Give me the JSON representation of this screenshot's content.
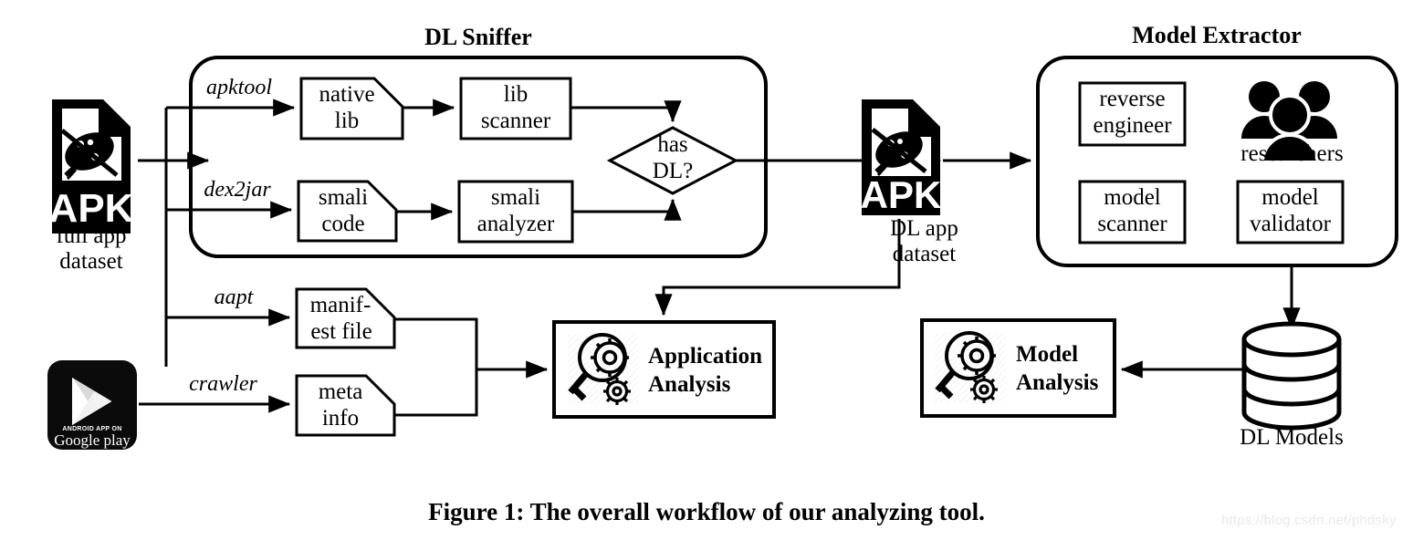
{
  "figure": {
    "caption": "Figure 1: The overall workflow of our analyzing tool.",
    "watermark": "https://blog.csdn.net/phdsky"
  },
  "groups": [
    {
      "id": "dl-sniffer",
      "title": "DL Sniffer"
    },
    {
      "id": "model-extractor",
      "title": "Model Extractor"
    }
  ],
  "sources": [
    {
      "id": "full-app-apk",
      "icon": "apk-file-icon",
      "label_line1": "full app",
      "label_line2": "dataset"
    },
    {
      "id": "google-play",
      "icon": "google-play-badge-icon",
      "badge_top": "ANDROID APP ON",
      "badge_main": "Google play"
    },
    {
      "id": "dl-app-apk",
      "icon": "apk-file-icon",
      "label_line1": "DL app",
      "label_line2": "dataset"
    }
  ],
  "edge_labels": {
    "apktool": "apktool",
    "dex2jar": "dex2jar",
    "aapt": "aapt",
    "crawler": "crawler"
  },
  "sniffer_nodes": [
    {
      "id": "native-lib",
      "shape": "document",
      "line1": "native",
      "line2": "lib"
    },
    {
      "id": "lib-scanner",
      "shape": "rect",
      "line1": "lib",
      "line2": "scanner"
    },
    {
      "id": "smali-code",
      "shape": "document",
      "line1": "smali",
      "line2": "code"
    },
    {
      "id": "smali-analyzer",
      "shape": "rect",
      "line1": "smali",
      "line2": "analyzer"
    },
    {
      "id": "has-dl",
      "shape": "diamond",
      "line1": "has",
      "line2": "DL?"
    }
  ],
  "artifact_nodes": [
    {
      "id": "manifest-file",
      "shape": "document",
      "line1": "manif-",
      "line2": "est file"
    },
    {
      "id": "meta-info",
      "shape": "document",
      "line1": "meta",
      "line2": "info"
    }
  ],
  "extractor_nodes": [
    {
      "id": "reverse-engineer",
      "shape": "rect",
      "line1": "reverse",
      "line2": "engineer"
    },
    {
      "id": "model-scanner",
      "shape": "rect",
      "line1": "model",
      "line2": "scanner"
    },
    {
      "id": "model-validator",
      "shape": "rect",
      "line1": "model",
      "line2": "validator"
    }
  ],
  "researchers": {
    "icon": "people-group-icon",
    "label": "researchers"
  },
  "analysis_nodes": [
    {
      "id": "application-analysis",
      "icon": "magnifier-gear-icon",
      "line1": "Application",
      "line2": "Analysis"
    },
    {
      "id": "model-analysis",
      "icon": "magnifier-gear-icon",
      "line1": "Model",
      "line2": "Analysis"
    }
  ],
  "database": {
    "id": "dl-models-db",
    "icon": "database-cylinder-icon",
    "label": "DL Models"
  },
  "colors": {
    "stroke": "#000000",
    "fill": "#ffffff",
    "watermark": "#e6e9ec"
  }
}
